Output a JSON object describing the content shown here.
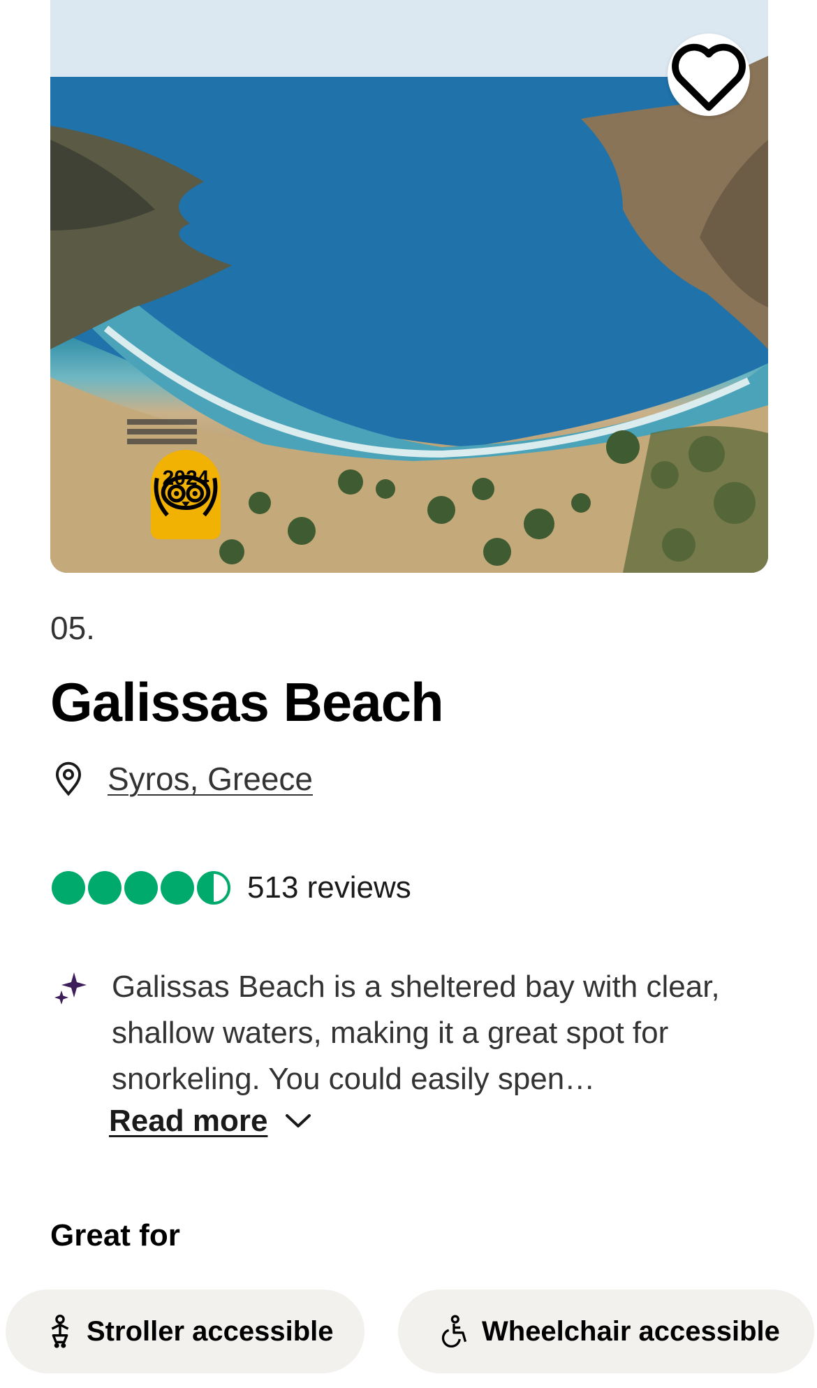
{
  "hero": {
    "award_year": "2024",
    "icons": {
      "favorite": "heart-icon",
      "award": "travelers-choice-owl-icon"
    }
  },
  "listing": {
    "rank": "05.",
    "title": "Galissas Beach",
    "location": "Syros, Greece",
    "rating_value": 4.5,
    "rating_max": 5,
    "reviews": "513 reviews"
  },
  "summary": {
    "text": "Galissas Beach is a sheltered bay with clear, shallow waters, making it a great spot for snorkeling. You could easily spen…",
    "read_more": "Read more"
  },
  "great_for": {
    "heading": "Great for",
    "chips": [
      {
        "label": "Stroller accessible",
        "icon": "stroller-icon"
      },
      {
        "label": "Wheelchair accessible",
        "icon": "wheelchair-icon"
      }
    ]
  },
  "colors": {
    "rating_green": "#00aa6c",
    "award_yellow": "#f2b203",
    "chip_background": "#f2f1ee",
    "sparkle_purple": "#3d1e5a"
  }
}
